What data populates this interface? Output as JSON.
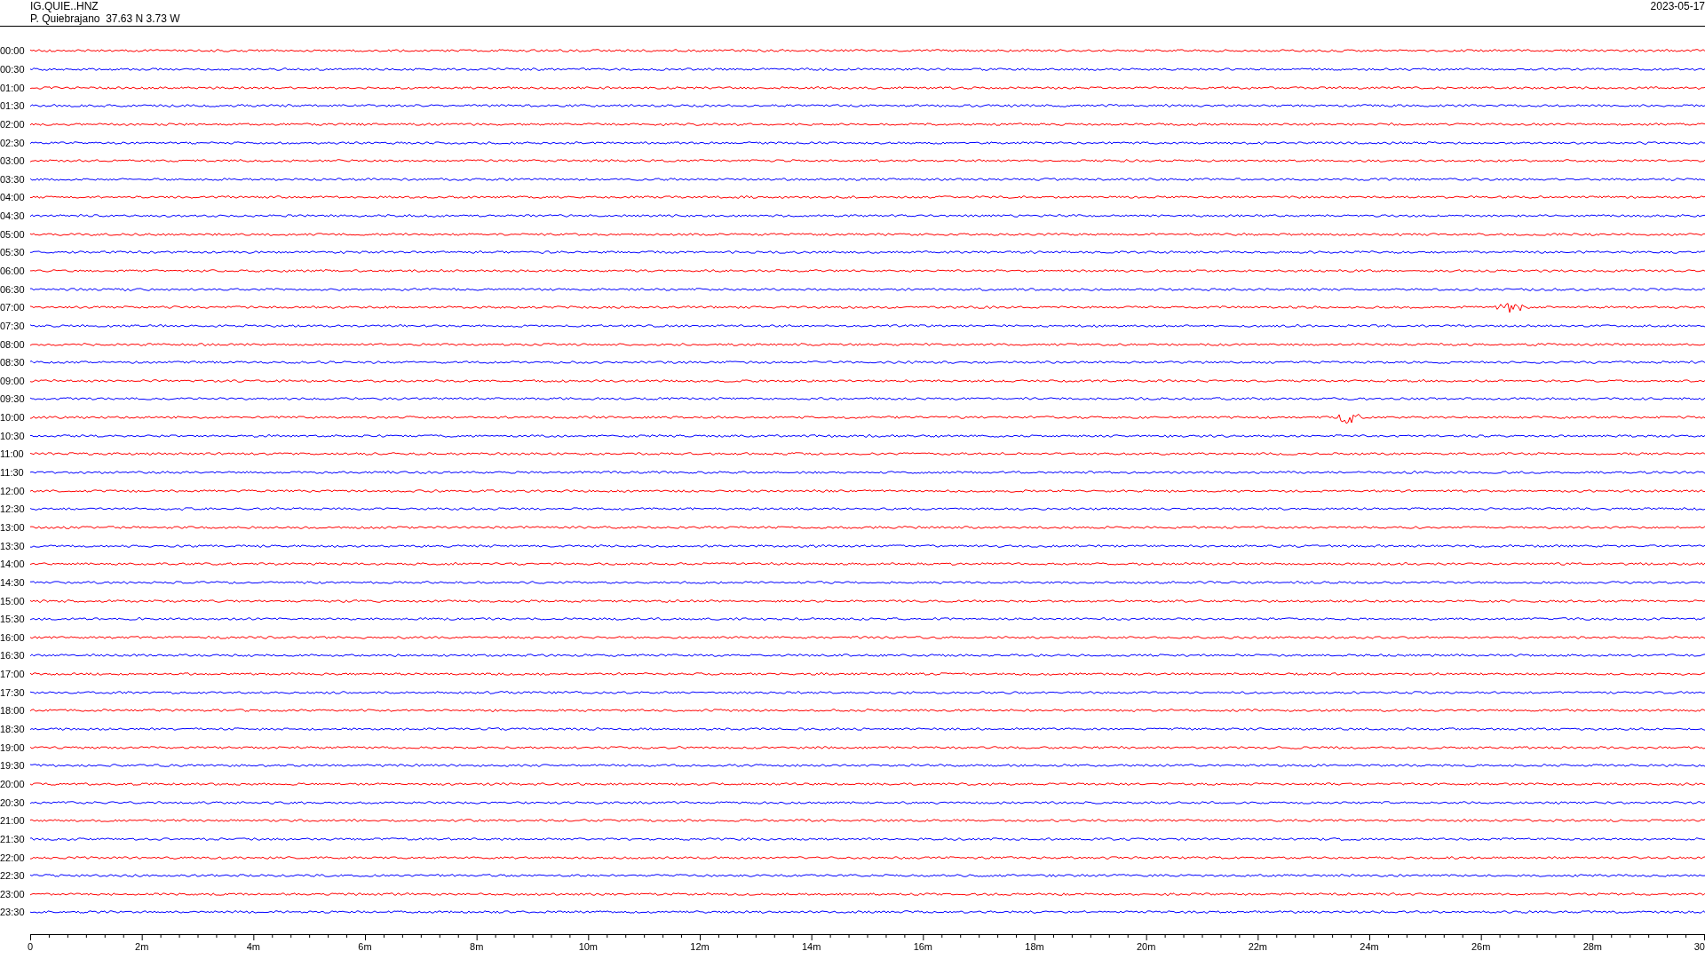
{
  "header": {
    "station": "IG.QUIE..HNZ",
    "location": "P. Quiebrajano  37.63 N 3.73 W",
    "date": "2023-05-17"
  },
  "traces": [
    {
      "time": "00:00",
      "color": "#ff0000"
    },
    {
      "time": "00:30",
      "color": "#0000ff"
    },
    {
      "time": "01:00",
      "color": "#ff0000"
    },
    {
      "time": "01:30",
      "color": "#0000ff"
    },
    {
      "time": "02:00",
      "color": "#ff0000"
    },
    {
      "time": "02:30",
      "color": "#0000ff"
    },
    {
      "time": "03:00",
      "color": "#ff0000"
    },
    {
      "time": "03:30",
      "color": "#0000ff"
    },
    {
      "time": "04:00",
      "color": "#ff0000"
    },
    {
      "time": "04:30",
      "color": "#0000ff"
    },
    {
      "time": "05:00",
      "color": "#ff0000"
    },
    {
      "time": "05:30",
      "color": "#0000ff"
    },
    {
      "time": "06:00",
      "color": "#ff0000"
    },
    {
      "time": "06:30",
      "color": "#0000ff"
    },
    {
      "time": "07:00",
      "color": "#ff0000"
    },
    {
      "time": "07:30",
      "color": "#0000ff"
    },
    {
      "time": "08:00",
      "color": "#ff0000"
    },
    {
      "time": "08:30",
      "color": "#0000ff"
    },
    {
      "time": "09:00",
      "color": "#ff0000"
    },
    {
      "time": "09:30",
      "color": "#0000ff"
    },
    {
      "time": "10:00",
      "color": "#ff0000"
    },
    {
      "time": "10:30",
      "color": "#0000ff"
    },
    {
      "time": "11:00",
      "color": "#ff0000"
    },
    {
      "time": "11:30",
      "color": "#0000ff"
    },
    {
      "time": "12:00",
      "color": "#ff0000"
    },
    {
      "time": "12:30",
      "color": "#0000ff"
    },
    {
      "time": "13:00",
      "color": "#ff0000"
    },
    {
      "time": "13:30",
      "color": "#0000ff"
    },
    {
      "time": "14:00",
      "color": "#ff0000"
    },
    {
      "time": "14:30",
      "color": "#0000ff"
    },
    {
      "time": "15:00",
      "color": "#ff0000"
    },
    {
      "time": "15:30",
      "color": "#0000ff"
    },
    {
      "time": "16:00",
      "color": "#ff0000"
    },
    {
      "time": "16:30",
      "color": "#0000ff"
    },
    {
      "time": "17:00",
      "color": "#ff0000"
    },
    {
      "time": "17:30",
      "color": "#0000ff"
    },
    {
      "time": "18:00",
      "color": "#ff0000"
    },
    {
      "time": "18:30",
      "color": "#0000ff"
    },
    {
      "time": "19:00",
      "color": "#ff0000"
    },
    {
      "time": "19:30",
      "color": "#0000ff"
    },
    {
      "time": "20:00",
      "color": "#ff0000"
    },
    {
      "time": "20:30",
      "color": "#0000ff"
    },
    {
      "time": "21:00",
      "color": "#ff0000"
    },
    {
      "time": "21:30",
      "color": "#0000ff"
    },
    {
      "time": "22:00",
      "color": "#ff0000"
    },
    {
      "time": "22:30",
      "color": "#0000ff"
    },
    {
      "time": "23:00",
      "color": "#ff0000"
    },
    {
      "time": "23:30",
      "color": "#0000ff"
    }
  ],
  "x_axis": {
    "labels": [
      "0",
      "2m",
      "4m",
      "6m",
      "8m",
      "10m",
      "12m",
      "14m",
      "16m",
      "18m",
      "20m",
      "22m",
      "24m",
      "26m",
      "28m",
      "30"
    ]
  }
}
